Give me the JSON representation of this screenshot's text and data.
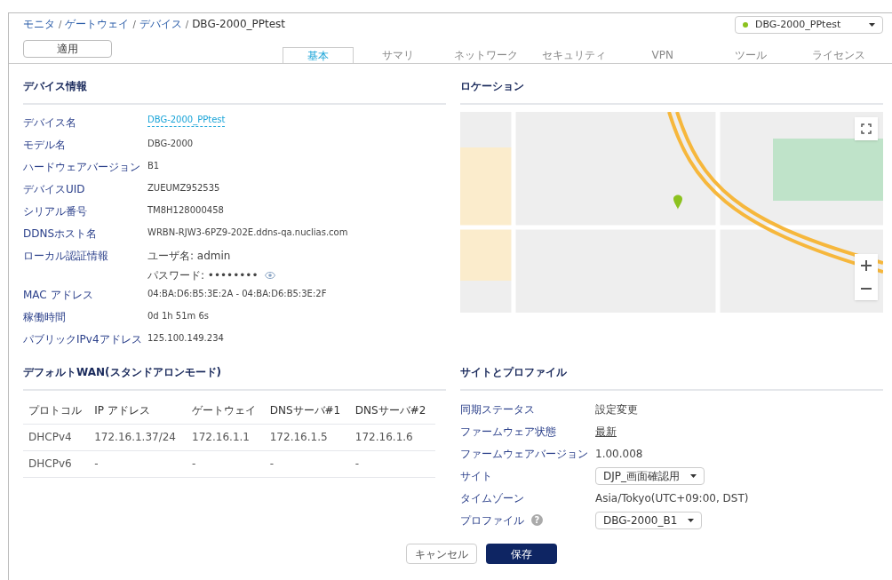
{
  "breadcrumb": [
    {
      "label": "モニタ",
      "link": true
    },
    {
      "label": "ゲートウェイ",
      "link": true
    },
    {
      "label": "デバイス",
      "link": true
    },
    {
      "label": "DBG-2000_PPtest",
      "link": false
    }
  ],
  "breadcrumb_separator": "/",
  "device_selector": {
    "value": "DBG-2000_PPtest",
    "color": "#8cc21f"
  },
  "apply_button": "適用",
  "tabs": [
    {
      "label": "基本",
      "selected": true
    },
    {
      "label": "サマリ",
      "selected": false
    },
    {
      "label": "ネットワーク",
      "selected": false
    },
    {
      "label": "セキュリティ",
      "selected": false
    },
    {
      "label": "VPN",
      "selected": false
    },
    {
      "label": "ツール",
      "selected": false
    },
    {
      "label": "ライセンス",
      "selected": false
    }
  ],
  "device_info": {
    "title": "デバイス情報",
    "rows": [
      {
        "kind": "link",
        "label": "デバイス名",
        "value": "DBG-2000_PPtest"
      },
      {
        "kind": "text",
        "label": "モデル名",
        "value": "DBG-2000"
      },
      {
        "kind": "text",
        "label": "ハードウェアバージョン",
        "value": "B1"
      },
      {
        "kind": "text",
        "label": "デバイスUID",
        "value": "ZUEUMZ952535"
      },
      {
        "kind": "text",
        "label": "シリアル番号",
        "value": "TM8H128000458"
      },
      {
        "kind": "text",
        "label": "DDNSホスト名",
        "value": "WRBN-RJW3-6PZ9-202E.ddns-qa.nuclias.com"
      },
      {
        "kind": "credentials",
        "label": "ローカル認証情報",
        "username": "ユーザ名: admin",
        "password": "パスワード: ••••••••"
      },
      {
        "kind": "text",
        "label": "MAC アドレス",
        "value": "04:BA:D6:B5:3E:2A - 04:BA:D6:B5:3E:2F"
      },
      {
        "kind": "text",
        "label": "稼働時間",
        "value": "0d 1h 51m 6s"
      },
      {
        "kind": "text",
        "label": "パブリックIPv4アドレス",
        "value": "125.100.149.234"
      }
    ]
  },
  "location": {
    "title": "ロケーション"
  },
  "wan": {
    "title": "デフォルトWAN(スタンドアロンモード)",
    "columns": [
      "プロトコル",
      "IP アドレス",
      "ゲートウェイ",
      "DNSサーバ#1",
      "DNSサーバ#2"
    ],
    "rows": [
      [
        "DHCPv4",
        "172.16.1.37/24",
        "172.16.1.1",
        "172.16.1.5",
        "172.16.1.6"
      ],
      [
        "DHCPv6",
        "-",
        "-",
        "-",
        "-"
      ]
    ]
  },
  "site_profile": {
    "title": "サイトとプロファイル",
    "help_symbol": "?",
    "rows": [
      {
        "kind": "text",
        "label": "同期ステータス",
        "value": "設定変更",
        "help": false
      },
      {
        "kind": "underlined",
        "label": "ファームウェア状態",
        "value": "最新",
        "help": false
      },
      {
        "kind": "text",
        "label": "ファームウェアバージョン",
        "value": "1.00.008",
        "help": false
      },
      {
        "kind": "select",
        "label": "サイト",
        "value": "DJP_画面確認用",
        "help": false
      },
      {
        "kind": "text",
        "label": "タイムゾーン",
        "value": "Asia/Tokyo(UTC+09:00, DST)",
        "help": false
      },
      {
        "kind": "select",
        "label": "プロファイル",
        "value": "DBG-2000_B1",
        "help": true
      }
    ]
  },
  "footer_buttons": [
    {
      "label": "キャンセル",
      "kind": "secondary"
    },
    {
      "label": "保存",
      "kind": "primary"
    }
  ]
}
